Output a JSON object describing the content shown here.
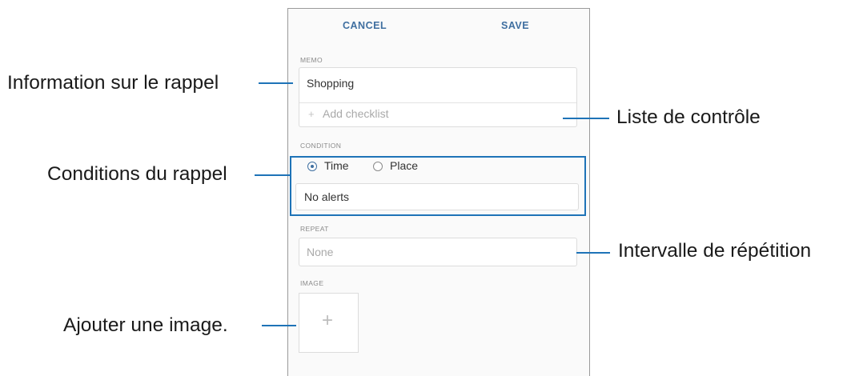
{
  "topbar": {
    "cancel_label": "CANCEL",
    "save_label": "SAVE"
  },
  "memo": {
    "section_label": "MEMO",
    "value": "Shopping",
    "checklist_placeholder": "Add checklist"
  },
  "condition": {
    "section_label": "CONDITION",
    "options": [
      {
        "label": "Time",
        "checked": true
      },
      {
        "label": "Place",
        "checked": false
      }
    ],
    "alert_value": "No alerts"
  },
  "repeat": {
    "section_label": "REPEAT",
    "value": "None"
  },
  "image": {
    "section_label": "IMAGE"
  },
  "callouts": {
    "reminder_info": "Information sur le rappel",
    "checklist": "Liste de contrôle",
    "conditions": "Conditions du rappel",
    "repeat_interval": "Intervalle de répétition",
    "add_image": "Ajouter une image."
  },
  "colors": {
    "accent": "#3f6fa0",
    "callout_line": "#1e73b7"
  },
  "icons": {
    "add_image": "plus-icon",
    "add_checklist": "plus-icon"
  }
}
